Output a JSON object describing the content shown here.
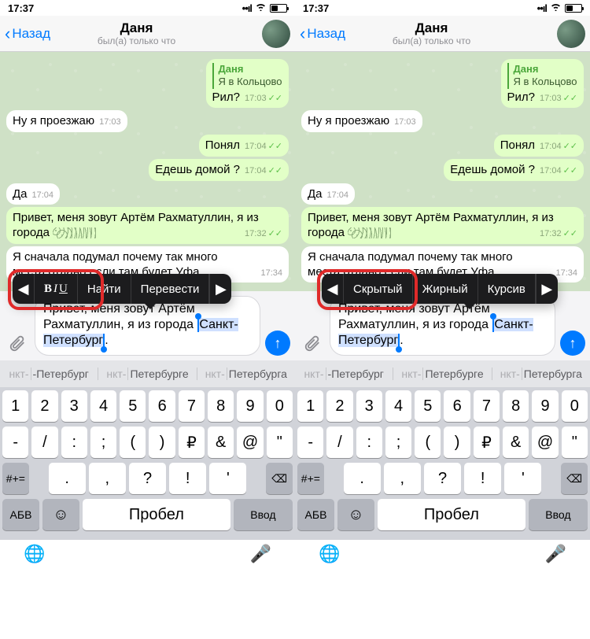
{
  "status": {
    "time": "17:37"
  },
  "nav": {
    "back": "Назад",
    "title": "Даня",
    "subtitle": "был(а) только что"
  },
  "messages": {
    "reply_name": "Даня",
    "reply_text": "Я в Кольцово",
    "m1_text": "Рил?",
    "m1_time": "17:03",
    "m2_text": "Ну я проезжаю",
    "m2_time": "17:03",
    "m3_text": "Понял",
    "m3_time": "17:04",
    "m4_text": "Едешь домой ?",
    "m4_time": "17:04",
    "m5_text": "Да",
    "m5_time": "17:04",
    "m6_pre": "Привет, меня зовут Артём Рахматуллин, я из города ",
    "m6_time": "17:32",
    "m7_line1": "Я сначала подумал почему так много",
    "m7_line2a": "места отдано если там будет Уфа",
    "m7_time": "17:34"
  },
  "composer": {
    "line1": "Привет, меня зовут Артём",
    "line2a": "Рахматуллин, я из города ",
    "sel1": "Санкт-",
    "sel2": "Петербург"
  },
  "menu_left": {
    "find": "Найти",
    "translate": "Перевести"
  },
  "menu_right": {
    "hidden": "Скрытый",
    "bold": "Жирный",
    "italic": "Курсив"
  },
  "suggestions": {
    "s1_pre": "нкт-",
    "s1": "-Петербург",
    "s2_pre": "нкт-",
    "s2": "Петербурге",
    "s3_pre": "нкт-",
    "s3": "Петербурга"
  },
  "kbd": {
    "r1": [
      "1",
      "2",
      "3",
      "4",
      "5",
      "6",
      "7",
      "8",
      "9",
      "0"
    ],
    "r2": [
      "-",
      "/",
      ":",
      ";",
      "(",
      ")",
      "₽",
      "&",
      "@",
      "\""
    ],
    "r3": [
      ".",
      ",",
      "?",
      "!",
      "'"
    ],
    "shift": "#+=",
    "abc": "АБВ",
    "space": "Пробел",
    "enter": "Ввод"
  }
}
